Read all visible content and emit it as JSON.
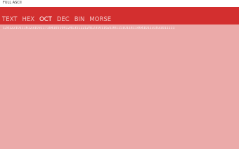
{
  "window": {
    "title": "FULL ASCII"
  },
  "tabs": [
    {
      "label": "TEXT",
      "active": false
    },
    {
      "label": "HEX",
      "active": false
    },
    {
      "label": "OCT",
      "active": true
    },
    {
      "label": "DEC",
      "active": false
    },
    {
      "label": "BIN",
      "active": false
    },
    {
      "label": "MORSE",
      "active": false
    }
  ],
  "output": {
    "text": "1241221011161231031171041051041241351221241231011621001151011411404101131031011111"
  },
  "colors": {
    "header": "#d32f2f",
    "content_background": "#ebaaa9",
    "active_tab": "#ffffff",
    "inactive_tab": "rgba(255,255,255,0.72)"
  }
}
